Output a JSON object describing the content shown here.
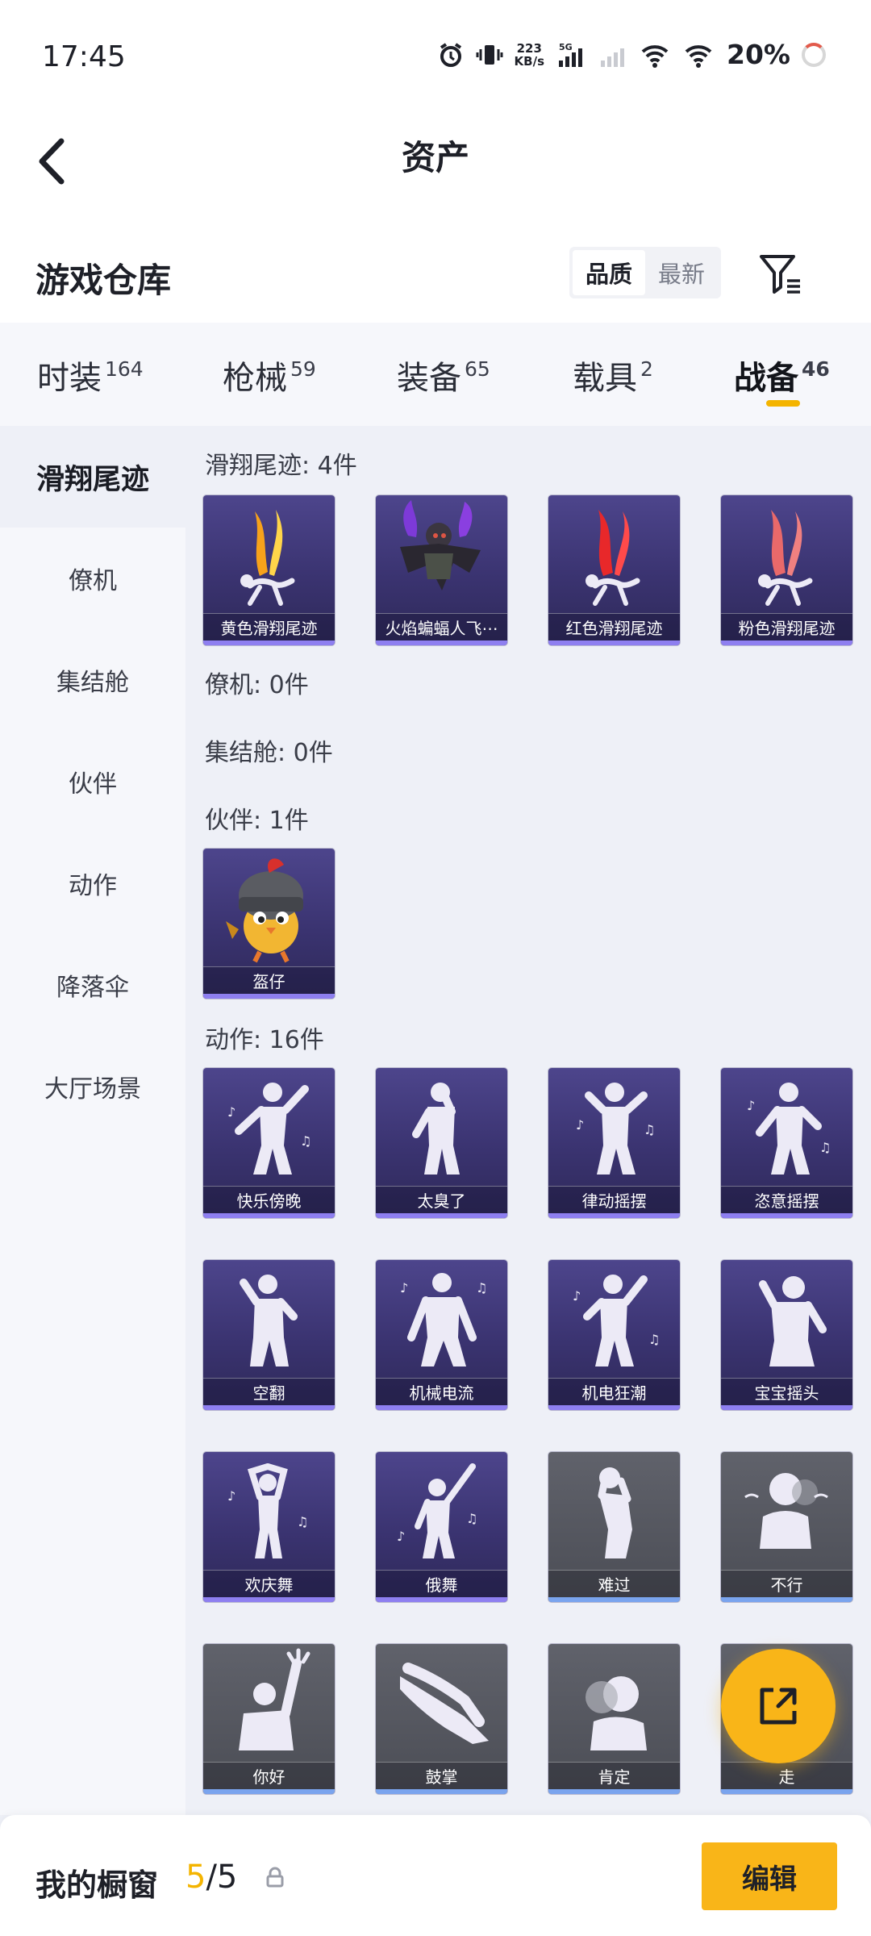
{
  "status": {
    "time": "17:45",
    "net_speed_top": "223",
    "net_speed_bottom": "KB/s",
    "net_type": "5G",
    "battery": "20%"
  },
  "header": {
    "title": "资产"
  },
  "section": {
    "title": "游戏仓库",
    "sort_options": [
      "品质",
      "最新"
    ],
    "active_sort": "品质"
  },
  "tabs": [
    {
      "label": "时装",
      "count": "164"
    },
    {
      "label": "枪械",
      "count": "59"
    },
    {
      "label": "装备",
      "count": "65"
    },
    {
      "label": "载具",
      "count": "2"
    },
    {
      "label": "战备",
      "count": "46"
    }
  ],
  "active_tab": "战备",
  "sidebar": {
    "items": [
      "滑翔尾迹",
      "僚机",
      "集结舱",
      "伙伴",
      "动作",
      "降落伞",
      "大厅场景"
    ],
    "active": "滑翔尾迹"
  },
  "groups": {
    "trail": {
      "label": "滑翔尾迹: 4件",
      "items": [
        "黄色滑翔尾迹",
        "火焰蝙蝠人飞⋯",
        "红色滑翔尾迹",
        "粉色滑翔尾迹"
      ]
    },
    "wingman": {
      "label": "僚机: 0件"
    },
    "capsule": {
      "label": "集结舱: 0件"
    },
    "partner": {
      "label": "伙伴: 1件",
      "items": [
        "盔仔"
      ]
    },
    "emote": {
      "label": "动作: 16件",
      "items": [
        "快乐傍晚",
        "太臭了",
        "律动摇摆",
        "恣意摇摆",
        "空翻",
        "机械电流",
        "机电狂潮",
        "宝宝摇头",
        "欢庆舞",
        "俄舞",
        "难过",
        "不行",
        "你好",
        "鼓掌",
        "肯定",
        "走"
      ]
    }
  },
  "bottom": {
    "showcase_label": "我的橱窗",
    "current": "5",
    "total": "/5",
    "edit_label": "编辑"
  },
  "colors": {
    "accent": "#F9B518",
    "card_purple": "#3A3370",
    "card_grey": "#4B4D55"
  }
}
